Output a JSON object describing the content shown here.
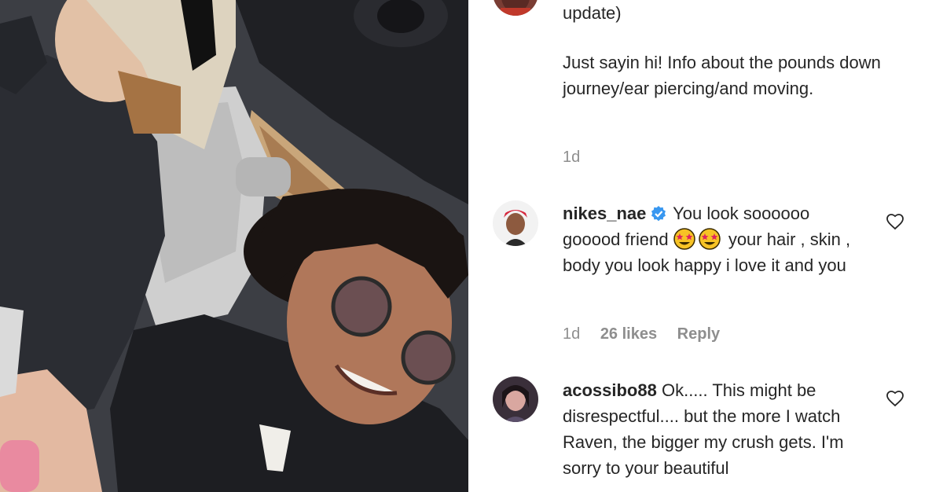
{
  "post": {
    "caption_tail": "update)",
    "caption_body": "Just sayin hi! Info about the pounds down journey/ear piercing/and moving.",
    "timestamp": "1d"
  },
  "comments": [
    {
      "username": "nikes_nae",
      "verified": true,
      "text_before_emoji": "You look soooooo gooood friend",
      "emoji_name": "star-struck-emoji",
      "text_after_emoji": "your hair , skin , body you look happy i love it and you",
      "time": "1d",
      "likes": "26 likes",
      "reply_label": "Reply"
    },
    {
      "username": "acossibo88",
      "verified": false,
      "text": "Ok..... This might be disrespectful.... but the more I watch Raven, the bigger my crush gets. I'm sorry to your beautiful"
    }
  ],
  "icons": {
    "like": "heart-outline-icon",
    "verified": "verified-badge-icon"
  },
  "colors": {
    "text_primary": "#262626",
    "text_secondary": "#8e8e8e",
    "verified_blue": "#3897f0"
  }
}
